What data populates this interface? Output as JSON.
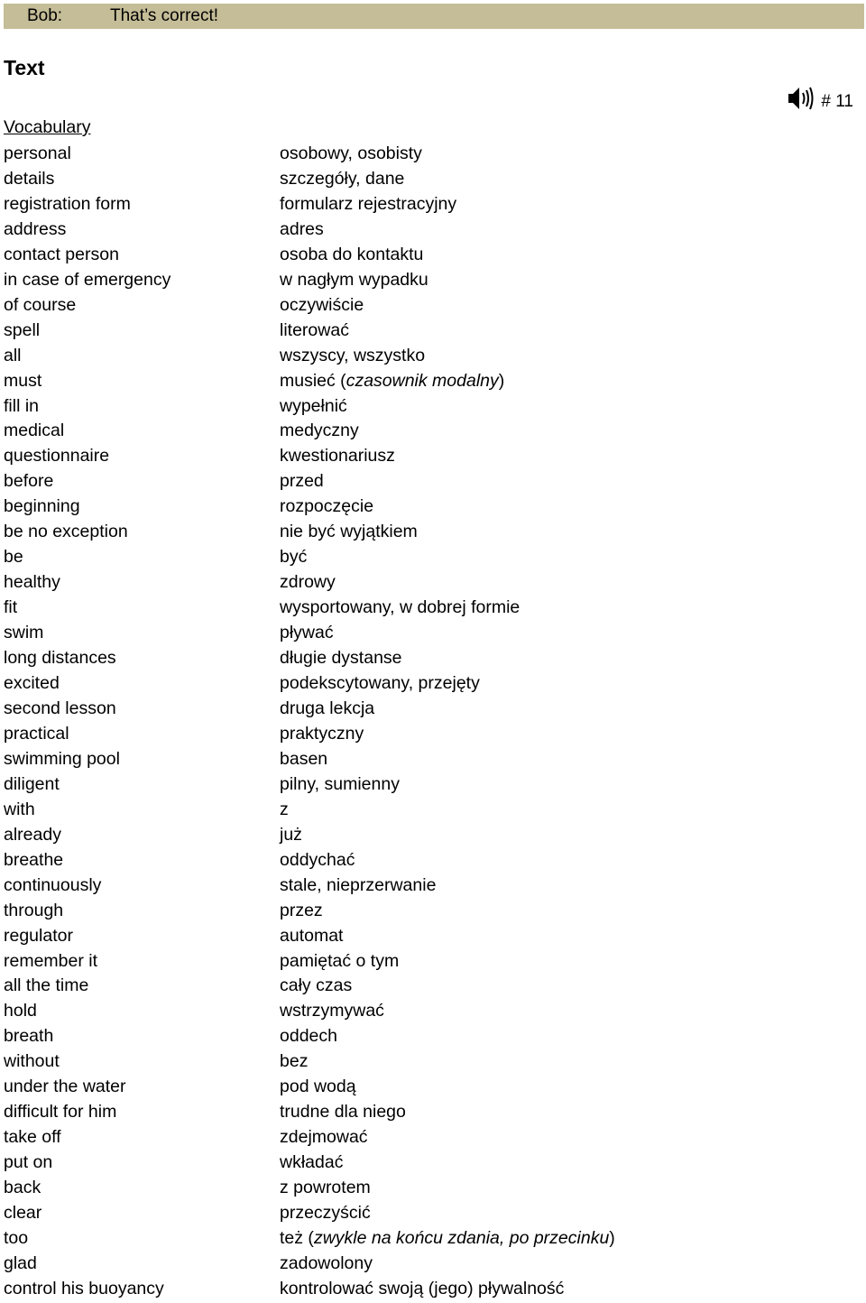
{
  "dialog": {
    "speaker": "Bob:",
    "line": "That’s correct!",
    "bar_color": "#c4bd97"
  },
  "section_title": "Text",
  "audio": {
    "icon": "speaker-icon",
    "track": "# 11"
  },
  "vocabulary": {
    "heading": "Vocabulary",
    "items": [
      {
        "en": "personal",
        "pl": "osobowy, osobisty"
      },
      {
        "en": "details",
        "pl": "szczegóły, dane"
      },
      {
        "en": "registration form",
        "pl": "formularz rejestracyjny"
      },
      {
        "en": "address",
        "pl": "adres"
      },
      {
        "en": "contact person",
        "pl": "osoba do kontaktu"
      },
      {
        "en": "in case of emergency",
        "pl": "w nagłym wypadku"
      },
      {
        "en": "of course",
        "pl": "oczywiście"
      },
      {
        "en": "spell",
        "pl": "literować"
      },
      {
        "en": "all",
        "pl": "wszyscy, wszystko"
      },
      {
        "en": "must",
        "pl": "musieć (",
        "pl_italic": "czasownik modalny",
        "pl_after": ")"
      },
      {
        "en": "fill in",
        "pl": "wypełnić"
      },
      {
        "en": "medical",
        "pl": "medyczny"
      },
      {
        "en": "questionnaire",
        "pl": "kwestionariusz"
      },
      {
        "en": "before",
        "pl": "przed"
      },
      {
        "en": "beginning",
        "pl": "rozpoczęcie"
      },
      {
        "en": "be no exception",
        "pl": "nie być wyjątkiem"
      },
      {
        "en": "be",
        "pl": "być"
      },
      {
        "en": "healthy",
        "pl": "zdrowy"
      },
      {
        "en": "fit",
        "pl": "wysportowany, w dobrej formie"
      },
      {
        "en": "swim",
        "pl": "pływać"
      },
      {
        "en": "long distances",
        "pl": "długie dystanse"
      },
      {
        "en": "excited",
        "pl": "podekscytowany, przejęty"
      },
      {
        "en": "second lesson",
        "pl": "druga lekcja"
      },
      {
        "en": "practical",
        "pl": "praktyczny"
      },
      {
        "en": "swimming pool",
        "pl": "basen"
      },
      {
        "en": "diligent",
        "pl": "pilny, sumienny"
      },
      {
        "en": "with",
        "pl": "z"
      },
      {
        "en": "already",
        "pl": "już"
      },
      {
        "en": "breathe",
        "pl": "oddychać"
      },
      {
        "en": "continuously",
        "pl": "stale, nieprzerwanie"
      },
      {
        "en": "through",
        "pl": "przez"
      },
      {
        "en": "regulator",
        "pl": "automat"
      },
      {
        "en": "remember it",
        "pl": "pamiętać o tym"
      },
      {
        "en": "all the time",
        "pl": "cały czas"
      },
      {
        "en": "hold",
        "pl": "wstrzymywać"
      },
      {
        "en": "breath",
        "pl": "oddech"
      },
      {
        "en": "without",
        "pl": "bez"
      },
      {
        "en": "under the water",
        "pl": "pod wodą"
      },
      {
        "en": "difficult for him",
        "pl": "trudne dla niego"
      },
      {
        "en": "take off",
        "pl": "zdejmować"
      },
      {
        "en": "put on",
        "pl": "wkładać"
      },
      {
        "en": "back",
        "pl": "z powrotem"
      },
      {
        "en": "clear",
        "pl": "przeczyścić"
      },
      {
        "en": "too",
        "pl": "też (",
        "pl_italic": "zwykle na końcu zdania, po przecinku",
        "pl_after": ")"
      },
      {
        "en": "glad",
        "pl": "zadowolony"
      },
      {
        "en": "control his buoyancy",
        "pl": "kontrolować swoją (jego) pływalność"
      }
    ]
  }
}
